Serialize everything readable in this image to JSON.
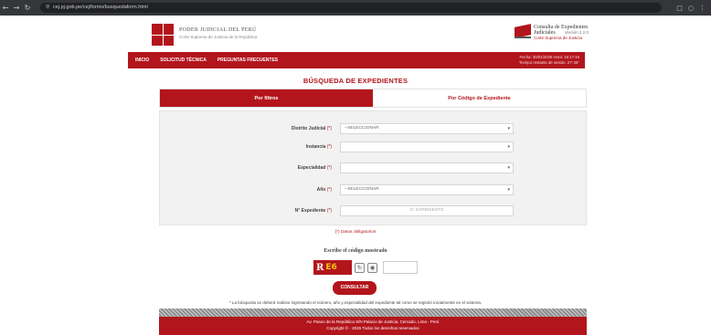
{
  "browser": {
    "url": "cej.pj.gob.pe/cej/forms/busquedaform.html",
    "back_icon": "back-arrow-icon",
    "forward_icon": "forward-arrow-icon",
    "reload_icon": "reload-icon"
  },
  "header": {
    "org_name": "PODER JUDICIAL DEL PERÚ",
    "org_sub": "Corte Suprema de Justicia de la República",
    "cej_title": "Consulta de Expedientes",
    "cej_title2": "Judiciales",
    "cej_version": "Versión 2.2.0",
    "cej_sub": "Corte Suprema de Justicia"
  },
  "nav": {
    "items": [
      "INICIO",
      "SOLICITUD TÉCNICA",
      "PREGUNTAS FRECUENTES"
    ],
    "info_line1": "Fecha: 30/01/2026 Hora: 16:17:16",
    "info_line2": "Tiempo restante de sesión: 27':45''"
  },
  "page_title": "BÚSQUEDA DE EXPEDIENTES",
  "tabs": [
    "Por filtros",
    "Por Código de Expediente"
  ],
  "form": {
    "required_mark": "(*)",
    "fields": [
      {
        "label": "Distrito Judicial",
        "value": "--SELECCIONAR",
        "type": "select"
      },
      {
        "label": "Instancia",
        "value": "",
        "type": "select"
      },
      {
        "label": "Especialidad",
        "value": "",
        "type": "select"
      },
      {
        "label": "Año",
        "value": "--SELECCIONAR",
        "type": "select"
      },
      {
        "label": "N° Expediente",
        "value": "N° EXPEDIENTE",
        "type": "input"
      }
    ]
  },
  "required_note": "(*) Datos obligatorios",
  "captcha": {
    "label": "Escribe el código mostrado",
    "text1": "R",
    "text2": "E6",
    "refresh_icon": "refresh-icon",
    "audio_icon": "audio-icon"
  },
  "submit_label": "CONSULTAR",
  "note": "* La búsqueda se deberá realizar ingresando el número, año y especialidad del expediente tal como se registró inicialmente en el sistema.",
  "footer": {
    "line1": "Av. Paseo de la República S/N Palacio de Justicia, Cercado, Lima - Perú",
    "line2": "Copyright © - 2026 Todos los derechos reservados"
  }
}
